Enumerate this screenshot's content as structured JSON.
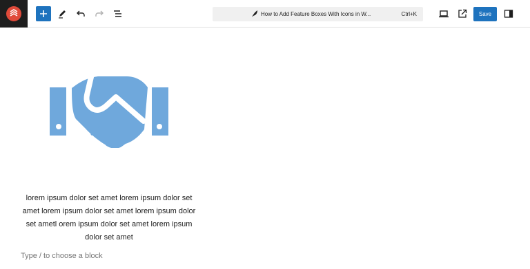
{
  "toolbar": {
    "command_title": "How to Add Feature Boxes With Icons in W...",
    "command_shortcut": "Ctrl+K",
    "save_label": "Save"
  },
  "content": {
    "paragraph": "lorem ipsum dolor set amet lorem ipsum dolor set amet lorem ipsum dolor set amet lorem ipsum dolor set ametl orem ipsum dolor set amet lorem ipsum dolor set amet",
    "placeholder": "Type / to choose a block"
  },
  "colors": {
    "accent": "#1e73be",
    "icon_fill": "#6fa8dc",
    "logo_bg": "#1e1e1e",
    "logo_red": "#e04a3a"
  },
  "icons": [
    "site-logo-icon",
    "add-block-icon",
    "edit-pencil-icon",
    "undo-icon",
    "redo-icon",
    "document-overview-icon",
    "feather-icon",
    "desktop-view-icon",
    "external-link-icon",
    "settings-sidebar-icon",
    "handshake-icon"
  ]
}
